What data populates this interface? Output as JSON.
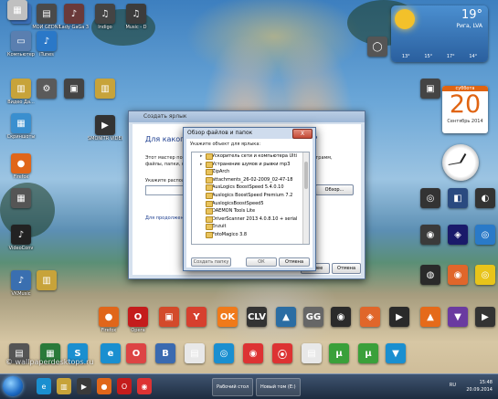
{
  "desktop": {
    "icons": [
      {
        "label": "",
        "color": "#3a6db5",
        "g": "▣"
      },
      {
        "label": "МОЙ GEDNE",
        "color": "#4a4a4a",
        "g": "▤"
      },
      {
        "label": "Lady GaGa 3",
        "color": "#6a3a3a",
        "g": "♪"
      },
      {
        "label": "Indigo",
        "color": "#444",
        "g": "♫"
      },
      {
        "label": "Music - D",
        "color": "#3c3c3c",
        "g": "♫"
      },
      {
        "label": "Компьютер",
        "color": "#5a7fb0",
        "g": "▭"
      },
      {
        "label": "iTunes",
        "color": "#2a78c8",
        "g": "♪"
      },
      {
        "label": "Видео Да...",
        "color": "#c7a33a",
        "g": "▥"
      },
      {
        "label": "",
        "color": "#5a5a5a",
        "g": "⚙"
      },
      {
        "label": "",
        "color": "#444",
        "g": "▣"
      },
      {
        "label": "",
        "color": "#c7a33a",
        "g": "▥"
      },
      {
        "label": "SMONITR VIDEO",
        "color": "#333",
        "g": "▶"
      },
      {
        "label": "Скриншоты",
        "color": "#3a8fcf",
        "g": "▦"
      },
      {
        "label": "Firefox",
        "color": "#e0661a",
        "g": "●"
      },
      {
        "label": "",
        "color": "#555",
        "g": "▦"
      },
      {
        "label": "VideoConv",
        "color": "#222",
        "g": "♪"
      },
      {
        "label": "",
        "color": "#c7a33a",
        "g": "▥"
      },
      {
        "label": "VKMusic",
        "color": "#3a6fb0",
        "g": "♪"
      },
      {
        "label": "Firefox",
        "color": "#e0661a",
        "g": "●"
      },
      {
        "label": "Opera",
        "color": "#c41c1c",
        "g": "O"
      },
      {
        "label": "",
        "color": "#d34a2a",
        "g": "▣"
      },
      {
        "label": "",
        "color": "#d6402e",
        "g": "Y"
      },
      {
        "label": "",
        "color": "#f07a1a",
        "g": "OK"
      },
      {
        "label": "",
        "color": "#333",
        "g": "CLV"
      },
      {
        "label": "",
        "color": "#2b6da3",
        "g": "▲"
      },
      {
        "label": "",
        "color": "#666",
        "g": "GG"
      },
      {
        "label": "",
        "color": "#2a2a2a",
        "g": "◉"
      },
      {
        "label": "",
        "color": "#e0662a",
        "g": "◈"
      },
      {
        "label": "",
        "color": "#2a2a2a",
        "g": "▶"
      },
      {
        "label": "",
        "color": "#e56a1a",
        "g": "▲"
      },
      {
        "label": "",
        "color": "#6a3aa0",
        "g": "▼"
      },
      {
        "label": "",
        "color": "#333",
        "g": "▶"
      },
      {
        "label": "",
        "color": "#555",
        "g": "▤"
      },
      {
        "label": "",
        "color": "#2a7a3a",
        "g": "▦"
      },
      {
        "label": "",
        "color": "#1a8fd0",
        "g": "S"
      },
      {
        "label": "",
        "color": "#1a8fd0",
        "g": "e"
      },
      {
        "label": "",
        "color": "#d44",
        "g": "O"
      },
      {
        "label": "",
        "color": "#3a6ab0",
        "g": "B"
      },
      {
        "label": "",
        "color": "#e8e8e8",
        "g": "▤"
      },
      {
        "label": "",
        "color": "#1a8fd0",
        "g": "◎"
      },
      {
        "label": "",
        "color": "#d33",
        "g": "◉"
      },
      {
        "label": "",
        "color": "#d33",
        "g": "⦿"
      },
      {
        "label": "",
        "color": "#e8e8e8",
        "g": "▤"
      },
      {
        "label": "",
        "color": "#3aa03a",
        "g": "µ"
      },
      {
        "label": "",
        "color": "#3aa03a",
        "g": "µ"
      },
      {
        "label": "",
        "color": "#1a8fd0",
        "g": "▼"
      },
      {
        "label": "",
        "color": "#333",
        "g": "◎"
      },
      {
        "label": "",
        "color": "#2a4a80",
        "g": "◧"
      },
      {
        "label": "",
        "color": "#333",
        "g": "◐"
      },
      {
        "label": "",
        "color": "#3a3a3a",
        "g": "◉"
      },
      {
        "label": "",
        "color": "#1a1a6a",
        "g": "◈"
      },
      {
        "label": "",
        "color": "#2a7ac8",
        "g": "◎"
      },
      {
        "label": "",
        "color": "#2a2a2a",
        "g": "◍"
      },
      {
        "label": "",
        "color": "#e0662a",
        "g": "◉"
      },
      {
        "label": "",
        "color": "#e8c41a",
        "g": "◎"
      },
      {
        "label": "",
        "color": "#444",
        "g": "▣"
      },
      {
        "label": "",
        "color": "#555",
        "g": "◯"
      },
      {
        "label": "",
        "color": "#c0c0c0",
        "g": "▦"
      }
    ],
    "watermark": "© wallpaperdesktops.ru"
  },
  "weather": {
    "temp": "19°",
    "city": "Рига, LVA",
    "forecast": [
      "13°",
      "15°",
      "17°",
      "14°"
    ]
  },
  "calendar": {
    "header": "суббота",
    "day": "20",
    "month": "Сентябрь 2014"
  },
  "wizard": {
    "title": "Создать ярлык",
    "heading": "Для какого элемента нужно создать ярлык?",
    "text1": "Этот мастер помогает создать ярлык для локальных или сетевых программ,",
    "text2": "файлы, папки, компьютеры или адреса Интернета.",
    "label": "Укажите расположение объекта:",
    "browse": "Обзор...",
    "hint": "Для продолжения нажмите кнопку \"Далее\".",
    "next": "Далее",
    "cancel": "Отмена"
  },
  "browse_dialog": {
    "title": "Обзор файлов и папок",
    "close": "X",
    "description": "Укажите объект для ярлыка:",
    "items": [
      {
        "label": "Ускоритель сети и компьютера Ulti",
        "expand": "▸"
      },
      {
        "label": "Устранение шумов и рывки mp3",
        "expand": "▸"
      },
      {
        "label": "ZipArch",
        "expand": ""
      },
      {
        "label": "attachments_26-02-2009_02-47-18",
        "expand": ""
      },
      {
        "label": "AusLogics BoostSpeed 5.4.0.10",
        "expand": ""
      },
      {
        "label": "Auslogics BoostSpeed Premium 7.2",
        "expand": ""
      },
      {
        "label": "AuslogicsBoostSpeed5",
        "expand": ""
      },
      {
        "label": "DAEMON Tools Lite",
        "expand": ""
      },
      {
        "label": "DriverScanner 2013 4.0.8.10 + serial",
        "expand": ""
      },
      {
        "label": "Enzuit",
        "expand": ""
      },
      {
        "label": "FotoMagico 3.8",
        "expand": ""
      }
    ],
    "make_folder": "Создать папку",
    "ok": "ОК",
    "cancel": "Отмена"
  },
  "taskbar": {
    "pinned": [
      {
        "g": "e",
        "color": "#1a8fd0"
      },
      {
        "g": "▥",
        "color": "#c7a33a"
      },
      {
        "g": "▶",
        "color": "#3a3a3a"
      },
      {
        "g": "●",
        "color": "#e0661a"
      },
      {
        "g": "O",
        "color": "#c41c1c"
      },
      {
        "g": "◉",
        "color": "#d33"
      }
    ],
    "tasks": [
      "Рабочий стол",
      "Новый том (E:)"
    ],
    "time": "15:48",
    "date": "20.09.2014",
    "lang": "RU"
  }
}
